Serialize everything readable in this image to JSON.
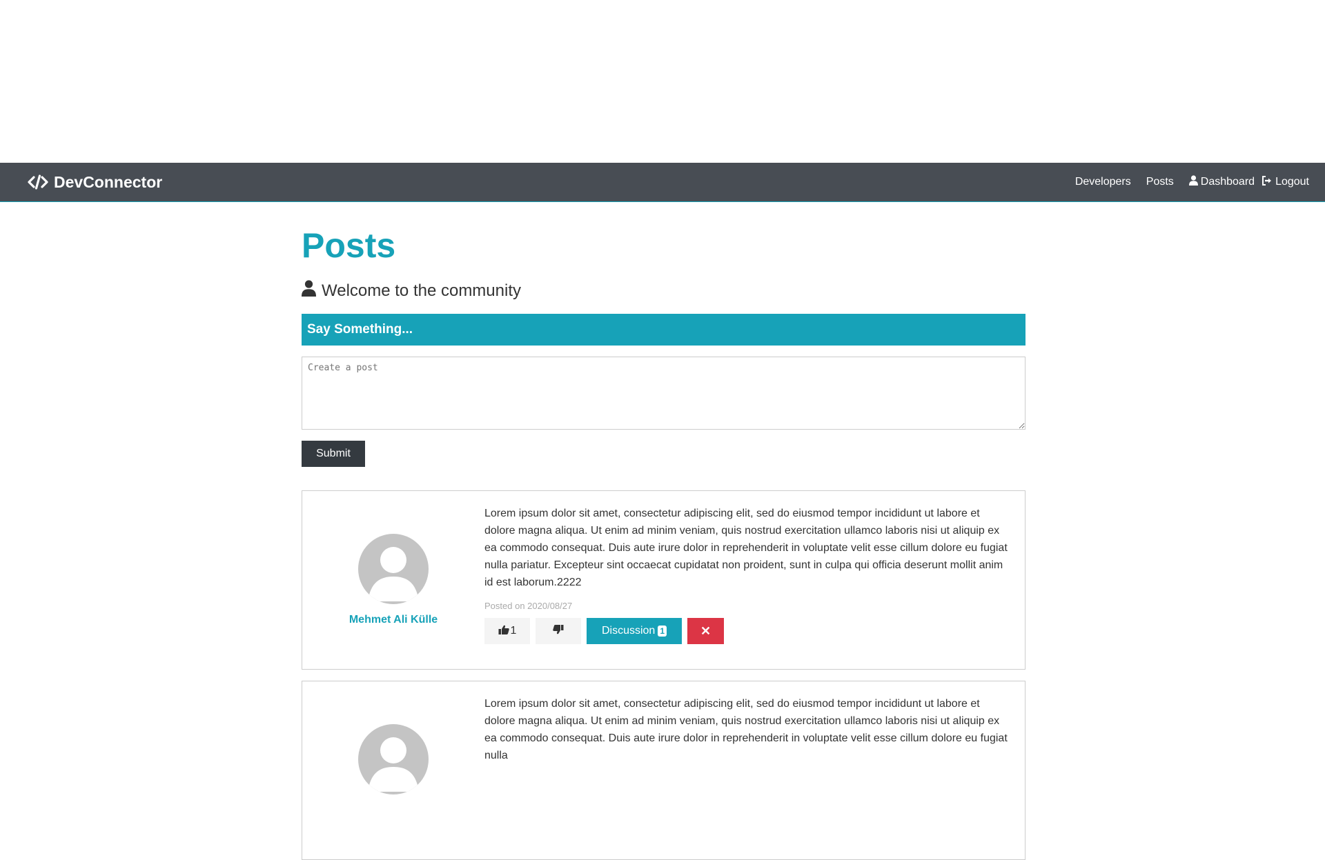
{
  "navbar": {
    "brand": "DevConnector",
    "links": {
      "developers": "Developers",
      "posts": "Posts",
      "dashboard": "Dashboard",
      "logout": "Logout"
    }
  },
  "page": {
    "title": "Posts",
    "lead": "Welcome to the community"
  },
  "post_form": {
    "header": "Say Something...",
    "placeholder": "Create a post",
    "submit_label": "Submit"
  },
  "posts": [
    {
      "author": "Mehmet Ali Külle",
      "text": "Lorem ipsum dolor sit amet, consectetur adipiscing elit, sed do eiusmod tempor incididunt ut labore et dolore magna aliqua. Ut enim ad minim veniam, quis nostrud exercitation ullamco laboris nisi ut aliquip ex ea commodo consequat. Duis aute irure dolor in reprehenderit in voluptate velit esse cillum dolore eu fugiat nulla pariatur. Excepteur sint occaecat cupidatat non proident, sunt in culpa qui officia deserunt mollit anim id est laborum.2222",
      "date": "Posted on 2020/08/27",
      "likes": "1",
      "discussion_label": "Discussion",
      "comment_count": "1",
      "delete_label": "✕"
    },
    {
      "text": "Lorem ipsum dolor sit amet, consectetur adipiscing elit, sed do eiusmod tempor incididunt ut labore et dolore magna aliqua. Ut enim ad minim veniam, quis nostrud exercitation ullamco laboris nisi ut aliquip ex ea commodo consequat. Duis aute irure dolor in reprehenderit in voluptate velit esse cillum dolore eu fugiat nulla"
    }
  ],
  "colors": {
    "navbar_bg": "#484d54",
    "primary": "#17a2b8",
    "dark": "#343a40",
    "danger": "#dc3545",
    "light": "#f4f4f4"
  }
}
